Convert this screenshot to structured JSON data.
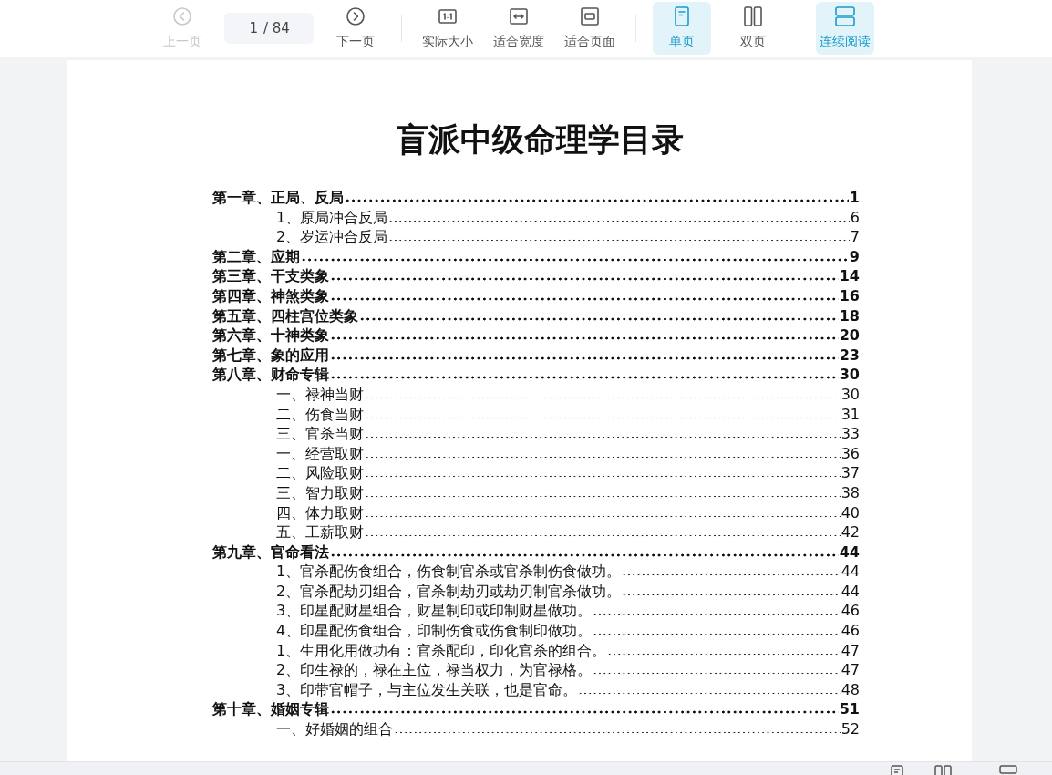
{
  "toolbar": [
    {
      "kind": "button",
      "label": "上一页",
      "disabled": true,
      "selected": false
    },
    {
      "kind": "pager",
      "value": "1",
      "total": "/ 84"
    },
    {
      "kind": "button",
      "label": "下一页",
      "disabled": false,
      "selected": false
    },
    {
      "kind": "divider"
    },
    {
      "kind": "button",
      "label": "实际大小",
      "disabled": false,
      "selected": false
    },
    {
      "kind": "button",
      "label": "适合宽度",
      "disabled": false,
      "selected": false
    },
    {
      "kind": "button",
      "label": "适合页面",
      "disabled": false,
      "selected": false
    },
    {
      "kind": "divider"
    },
    {
      "kind": "button",
      "label": "单页",
      "disabled": false,
      "selected": true
    },
    {
      "kind": "button",
      "label": "双页",
      "disabled": false,
      "selected": false
    },
    {
      "kind": "divider"
    },
    {
      "kind": "button",
      "label": "连续阅读",
      "disabled": false,
      "selected": true
    }
  ],
  "document": {
    "title": "盲派中级命理学目录",
    "toc": [
      {
        "title": "第一章、正局、反局",
        "page": "1",
        "children": [
          {
            "title": "1、原局冲合反局",
            "page": "6"
          },
          {
            "title": "2、岁运冲合反局",
            "page": "7"
          }
        ]
      },
      {
        "title": "第二章、应期",
        "page": "9"
      },
      {
        "title": "第三章、干支类象",
        "page": "14"
      },
      {
        "title": "第四章、神煞类象",
        "page": "16"
      },
      {
        "title": "第五章、四柱宫位类象",
        "page": "18"
      },
      {
        "title": "第六章、十神类象",
        "page": "20"
      },
      {
        "title": "第七章、象的应用",
        "page": "23"
      },
      {
        "title": "第八章、财命专辑",
        "page": "30",
        "children": [
          {
            "title": "一、禄神当财",
            "page": "30"
          },
          {
            "title": "二、伤食当财",
            "page": "31"
          },
          {
            "title": "三、官杀当财",
            "page": "33"
          },
          {
            "title": "一、经营取财",
            "page": "36"
          },
          {
            "title": "二、风险取财",
            "page": "37"
          },
          {
            "title": "三、智力取财",
            "page": "38"
          },
          {
            "title": "四、体力取财",
            "page": "40"
          },
          {
            "title": "五、工薪取财",
            "page": "42"
          }
        ]
      },
      {
        "title": "第九章、官命看法",
        "page": "44",
        "children": [
          {
            "title": "1、官杀配伤食组合，伤食制官杀或官杀制伤食做功。",
            "page": "44"
          },
          {
            "title": "2、官杀配劫刃组合，官杀制劫刃或劫刃制官杀做功。",
            "page": "44"
          },
          {
            "title": "3、印星配财星组合，财星制印或印制财星做功。",
            "page": "46"
          },
          {
            "title": "4、印星配伤食组合，印制伤食或伤食制印做功。",
            "page": "46"
          },
          {
            "title": "1、生用化用做功有：官杀配印，印化官杀的组合。",
            "page": "47"
          },
          {
            "title": "2、印生禄的，禄在主位，禄当权力，为官禄格。",
            "page": "47"
          },
          {
            "title": "3、印带官帽子，与主位发生关联，也是官命。",
            "page": "48"
          }
        ]
      },
      {
        "title": "第十章、婚姻专辑",
        "page": "51",
        "children": [
          {
            "title": "一、好婚姻的组合",
            "page": "52"
          }
        ]
      }
    ]
  }
}
